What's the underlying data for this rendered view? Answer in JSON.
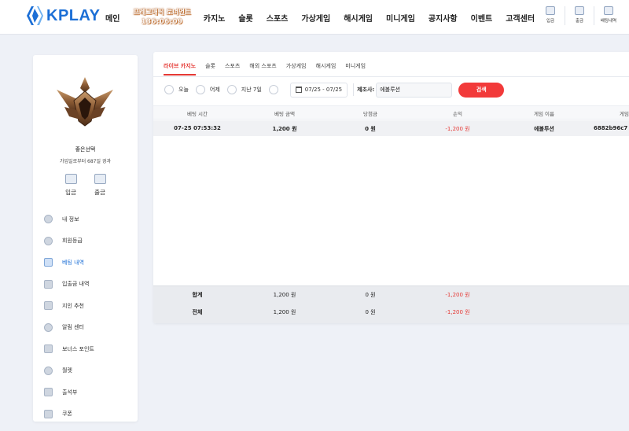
{
  "header": {
    "logo_text": "KPLAY",
    "nav": [
      "메인",
      "카지노",
      "슬롯",
      "스포츠",
      "가상게임",
      "해시게임",
      "미니게임",
      "공지사항",
      "이벤트",
      "고객센터"
    ],
    "promo": {
      "line1": "프레그매틱 토너먼트",
      "line2": "136:06:09"
    },
    "icons": [
      {
        "label": "입금",
        "icon": "deposit-icon"
      },
      {
        "label": "출금",
        "icon": "withdraw-icon"
      },
      {
        "label": "배팅내역",
        "icon": "betting-history-icon"
      }
    ]
  },
  "sidebar": {
    "user_name": "좋은선택",
    "since": "가입일로부터 687일 경과",
    "deposit": "입금",
    "withdraw": "출금",
    "items": [
      {
        "label": "내 정보",
        "icon": "profile-icon"
      },
      {
        "label": "회원등급",
        "icon": "grade-icon"
      },
      {
        "label": "베팅 내역",
        "icon": "betting-history-icon",
        "active": true
      },
      {
        "label": "입출금 내역",
        "icon": "transaction-icon"
      },
      {
        "label": "지인 추천",
        "icon": "referral-icon"
      },
      {
        "label": "알림 센터",
        "icon": "notification-icon"
      },
      {
        "label": "보너스 포인트",
        "icon": "bonus-icon"
      },
      {
        "label": "월렛",
        "icon": "wallet-icon"
      },
      {
        "label": "출석부",
        "icon": "attendance-icon"
      },
      {
        "label": "쿠폰",
        "icon": "coupon-icon"
      }
    ]
  },
  "tabs": [
    "라이브 카지노",
    "슬롯",
    "스포츠",
    "해외 스포츠",
    "가상게임",
    "해시게임",
    "미니게임"
  ],
  "filter": {
    "today": "오늘",
    "yesterday": "어제",
    "last7": "지난 7일",
    "date_range": "07/25 - 07/25",
    "provider_label": "제조사:",
    "provider_value": "에볼루션",
    "search": "검색"
  },
  "table": {
    "columns": [
      "베팅 시간",
      "베팅 금액",
      "당첨금",
      "손익",
      "게임 이름",
      "게임"
    ],
    "rows": [
      {
        "time": "07-25 07:53:32",
        "bet": "1,200 원",
        "win": "0 원",
        "profit": "-1,200 원",
        "game": "에볼루션",
        "id": "6882b96c7"
      }
    ],
    "summary": [
      {
        "label": "합계",
        "bet": "1,200 원",
        "win": "0 원",
        "profit": "-1,200 원"
      },
      {
        "label": "전체",
        "bet": "1,200 원",
        "win": "0 원",
        "profit": "-1,200 원"
      }
    ]
  },
  "colors": {
    "accent": "#f23a3a",
    "brand": "#1c6fd6",
    "negative": "#e53935"
  }
}
